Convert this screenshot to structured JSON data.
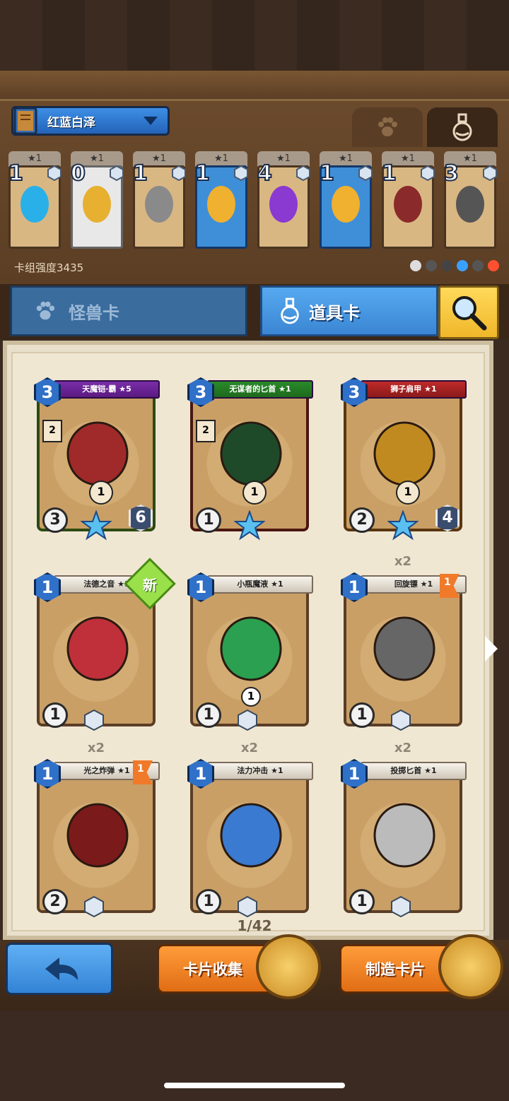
{
  "deck": {
    "name": "红蓝白泽",
    "power": "卡组强度3435",
    "cards": [
      {
        "tag": "★1",
        "count": "1",
        "style": "tan",
        "art": "blue-egg"
      },
      {
        "tag": "★1",
        "count": "0",
        "style": "white",
        "art": "gold-medal"
      },
      {
        "tag": "★1",
        "count": "1",
        "style": "tan",
        "art": "boomerang"
      },
      {
        "tag": "★1",
        "count": "1",
        "style": "blue",
        "art": "gold-leaf"
      },
      {
        "tag": "★1",
        "count": "4",
        "style": "tan",
        "art": "purple-potion"
      },
      {
        "tag": "★1",
        "count": "1",
        "style": "blue",
        "art": "gold-leaf"
      },
      {
        "tag": "★1",
        "count": "1",
        "style": "tan",
        "art": "bombs"
      },
      {
        "tag": "★1",
        "count": "3",
        "style": "tan",
        "art": "bomb-pot"
      }
    ]
  },
  "tabs": {
    "monster": "怪兽卡",
    "item": "道具卡"
  },
  "cards": [
    {
      "name": "天魔铠·霸 ★5",
      "cost": "3",
      "left": "3",
      "right": "6",
      "sub": "1",
      "side": "2",
      "style": "green"
    },
    {
      "name": "无谋者的匕首 ★1",
      "cost": "3",
      "left": "1",
      "right": "",
      "sub": "1",
      "side": "2",
      "style": "red"
    },
    {
      "name": "狮子肩甲 ★1",
      "cost": "3",
      "left": "2",
      "right": "4",
      "sub": "1",
      "side": "",
      "style": "gold"
    },
    {
      "name": "法德之音 ★1",
      "cost": "1",
      "left": "1",
      "multiplier": ""
    },
    {
      "name": "小瓶魔液 ★1",
      "cost": "1",
      "left": "1",
      "sub": "1",
      "multiplier": ""
    },
    {
      "name": "回旋镖 ★1",
      "cost": "1",
      "left": "1",
      "flag": "1",
      "multiplier": "x2"
    },
    {
      "name": "光之炸弹 ★1",
      "cost": "1",
      "left": "2",
      "flag": "1",
      "multiplier": "x2"
    },
    {
      "name": "法力冲击 ★1",
      "cost": "1",
      "left": "1",
      "multiplier": "x2"
    },
    {
      "name": "投掷匕首 ★1",
      "cost": "1",
      "left": "1",
      "multiplier": "x2"
    }
  ],
  "new_badge": "新",
  "page": "1/42",
  "buttons": {
    "collect": "卡片收集",
    "craft": "制造卡片"
  },
  "colors": {
    "accent_blue": "#3b86d4",
    "accent_orange": "#e06d14"
  }
}
